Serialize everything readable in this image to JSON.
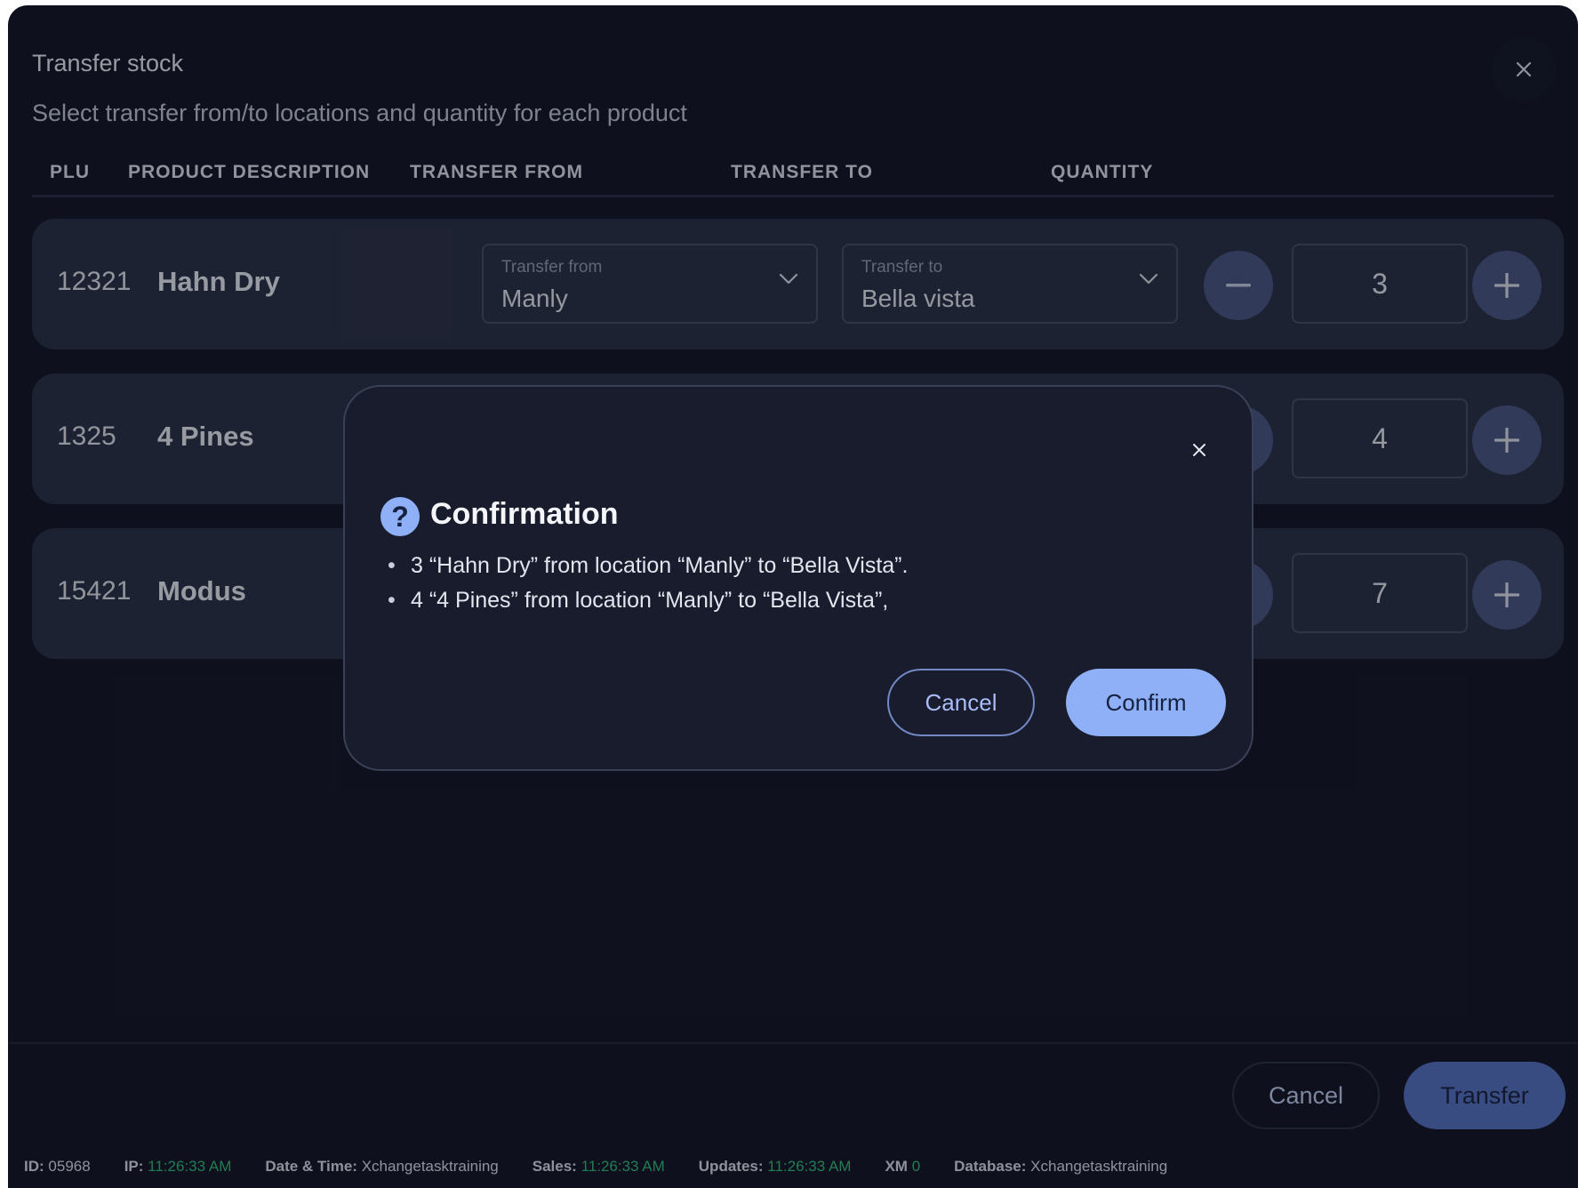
{
  "dialog": {
    "title": "Transfer stock",
    "subtitle": "Select transfer from/to locations and quantity for each product"
  },
  "columns": {
    "plu": "PLU",
    "description": "PRODUCT DESCRIPTION",
    "from": "TRANSFER FROM",
    "to": "TRANSFER TO",
    "quantity": "QUANTITY"
  },
  "rows": [
    {
      "plu": "12321",
      "name": "Hahn Dry",
      "from_label": "Transfer from",
      "from_value": "Manly",
      "to_label": "Transfer to",
      "to_value": "Bella vista",
      "quantity": "3"
    },
    {
      "plu": "1325",
      "name": "4 Pines",
      "quantity": "4"
    },
    {
      "plu": "15421",
      "name": "Modus",
      "quantity": "7"
    }
  ],
  "footer": {
    "cancel": "Cancel",
    "transfer": "Transfer"
  },
  "statusbar": {
    "id_label": "ID:",
    "id_value": "05968",
    "ip_label": "IP:",
    "ip_value": "11:26:33 AM",
    "datetime_label": "Date & Time:",
    "datetime_value": "Xchangetasktraining",
    "sales_label": "Sales:",
    "sales_value": "11:26:33 AM",
    "updates_label": "Updates:",
    "updates_value": "11:26:33 AM",
    "xm_label": "XM",
    "xm_value": "0",
    "database_label": "Database:",
    "database_value": "Xchangetasktraining"
  },
  "confirmation": {
    "icon": "question-icon",
    "icon_glyph": "?",
    "title": "Confirmation",
    "items": [
      "3 “Hahn Dry” from location “Manly” to “Bella Vista”.",
      "4 “4 Pines” from location “Manly” to “Bella Vista”,"
    ],
    "bullet": "•",
    "cancel": "Cancel",
    "confirm": "Confirm"
  },
  "colors": {
    "background": "#141726",
    "row": "#2c3247",
    "accent": "#8fb0f6",
    "stepper": "#4c5a86",
    "status_green": "#35c27c"
  }
}
